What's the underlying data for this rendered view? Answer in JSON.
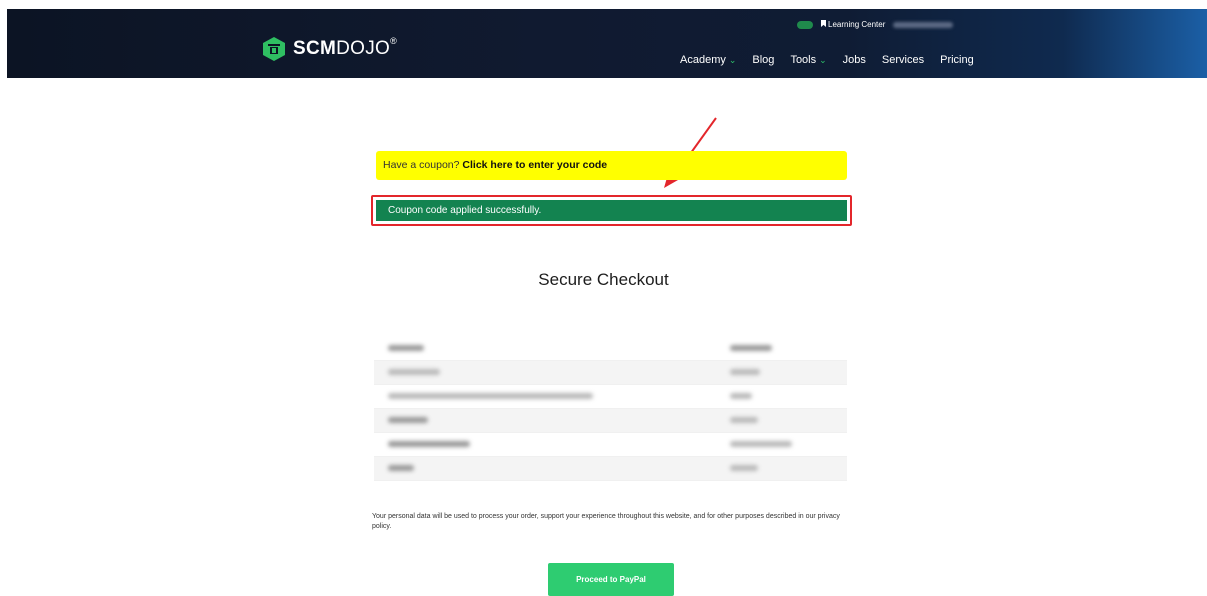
{
  "header": {
    "logo_text_bold": "SCM",
    "logo_text_thin": "DOJO",
    "logo_registered": "®",
    "learning_center": "Learning Center",
    "nav": [
      {
        "label": "Academy",
        "has_dropdown": true
      },
      {
        "label": "Blog",
        "has_dropdown": false
      },
      {
        "label": "Tools",
        "has_dropdown": true
      },
      {
        "label": "Jobs",
        "has_dropdown": false
      },
      {
        "label": "Services",
        "has_dropdown": false
      },
      {
        "label": "Pricing",
        "has_dropdown": false
      }
    ]
  },
  "coupon": {
    "prompt": "Have a coupon?",
    "link": "Click here to enter your code",
    "success_message": "Coupon code applied successfully."
  },
  "checkout": {
    "title": "Secure Checkout",
    "policy_text": "Your personal data will be used to process your order, support your experience throughout this website, and for other purposes described in our privacy policy.",
    "paypal_button": "Proceed to PayPal"
  },
  "colors": {
    "coupon_bar": "#ffff00",
    "success_bar": "#138350",
    "highlight_outline": "#e3262b",
    "paypal_button": "#2ecc71"
  }
}
